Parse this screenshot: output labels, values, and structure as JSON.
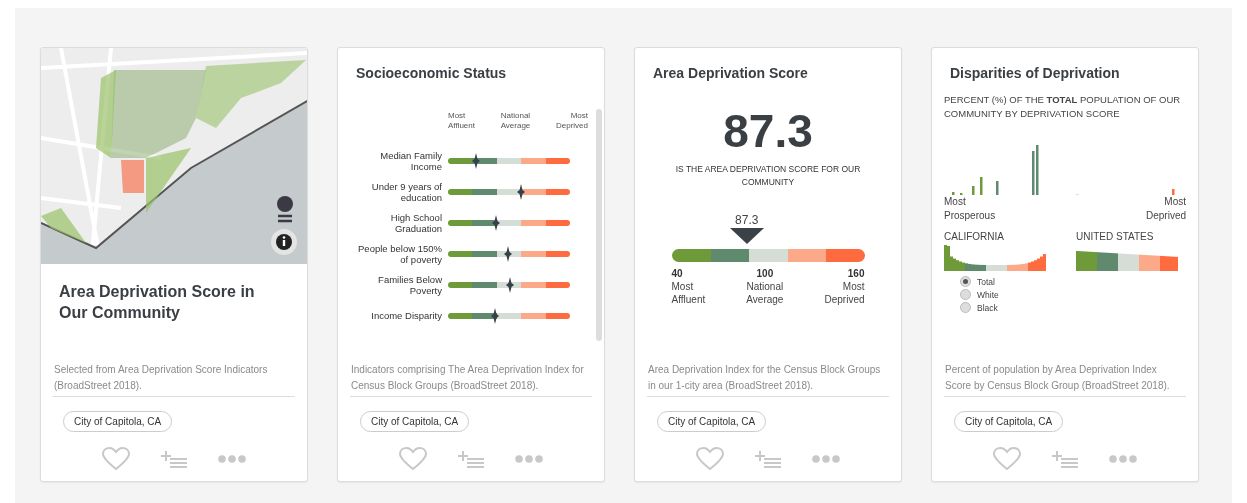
{
  "cards": [
    {
      "kind": "map",
      "title": "Area Deprivation Score in Our Community",
      "description": "Selected from Area Deprivation Score Indicators (BroadStreet 2018).",
      "tag": "City of Capitola, CA"
    },
    {
      "kind": "indicators",
      "title": "Socioeconomic Status",
      "scale_labels": [
        "Most Affluent",
        "National Average",
        "Most Deprived"
      ],
      "indicators": [
        {
          "label": "Median Family Income",
          "level": 0.23
        },
        {
          "label": "Under 9 years of education",
          "level": 0.6
        },
        {
          "label": "High School Graduation",
          "level": 0.39
        },
        {
          "label": "People below 150% of poverty",
          "level": 0.49
        },
        {
          "label": "Families Below Poverty",
          "level": 0.51
        },
        {
          "label": "Income Disparity",
          "level": 0.385
        }
      ],
      "description": "Indicators comprising The Area Deprivation Index for Census Block Groups (BroadStreet 2018).",
      "tag": "City of Capitola, CA"
    },
    {
      "kind": "score",
      "title": "Area Deprivation Score",
      "score": "87.3",
      "score_caption": "IS THE AREA DEPRIVATION SCORE FOR OUR COMMUNITY",
      "marker_label": "87.3",
      "ticks": [
        {
          "value": "40",
          "label": "Most Affluent"
        },
        {
          "value": "100",
          "label": "National Average"
        },
        {
          "value": "160",
          "label": "Most Deprived"
        }
      ],
      "description": "Area Deprivation Index for the Census Block Groups in our 1-city area (BroadStreet 2018).",
      "tag": "City of Capitola, CA"
    },
    {
      "kind": "disparities",
      "title": "Disparities of Deprivation",
      "subtitle": "PERCENT (%) OF THE **TOTAL** POPULATION OF OUR COMMUNITY BY DEPRIVATION SCORE",
      "axis_labels": [
        "Most Prosperous",
        "Most Deprived"
      ],
      "regions": [
        "CALIFORNIA",
        "UNITED STATES"
      ],
      "options": [
        {
          "label": "Total",
          "selected": true
        },
        {
          "label": "White",
          "selected": false
        },
        {
          "label": "Black",
          "selected": false
        }
      ],
      "description": "Percent of population by Area Deprivation Index Score by Census Block Group (BroadStreet 2018).",
      "tag": "City of Capitola, CA"
    }
  ]
}
